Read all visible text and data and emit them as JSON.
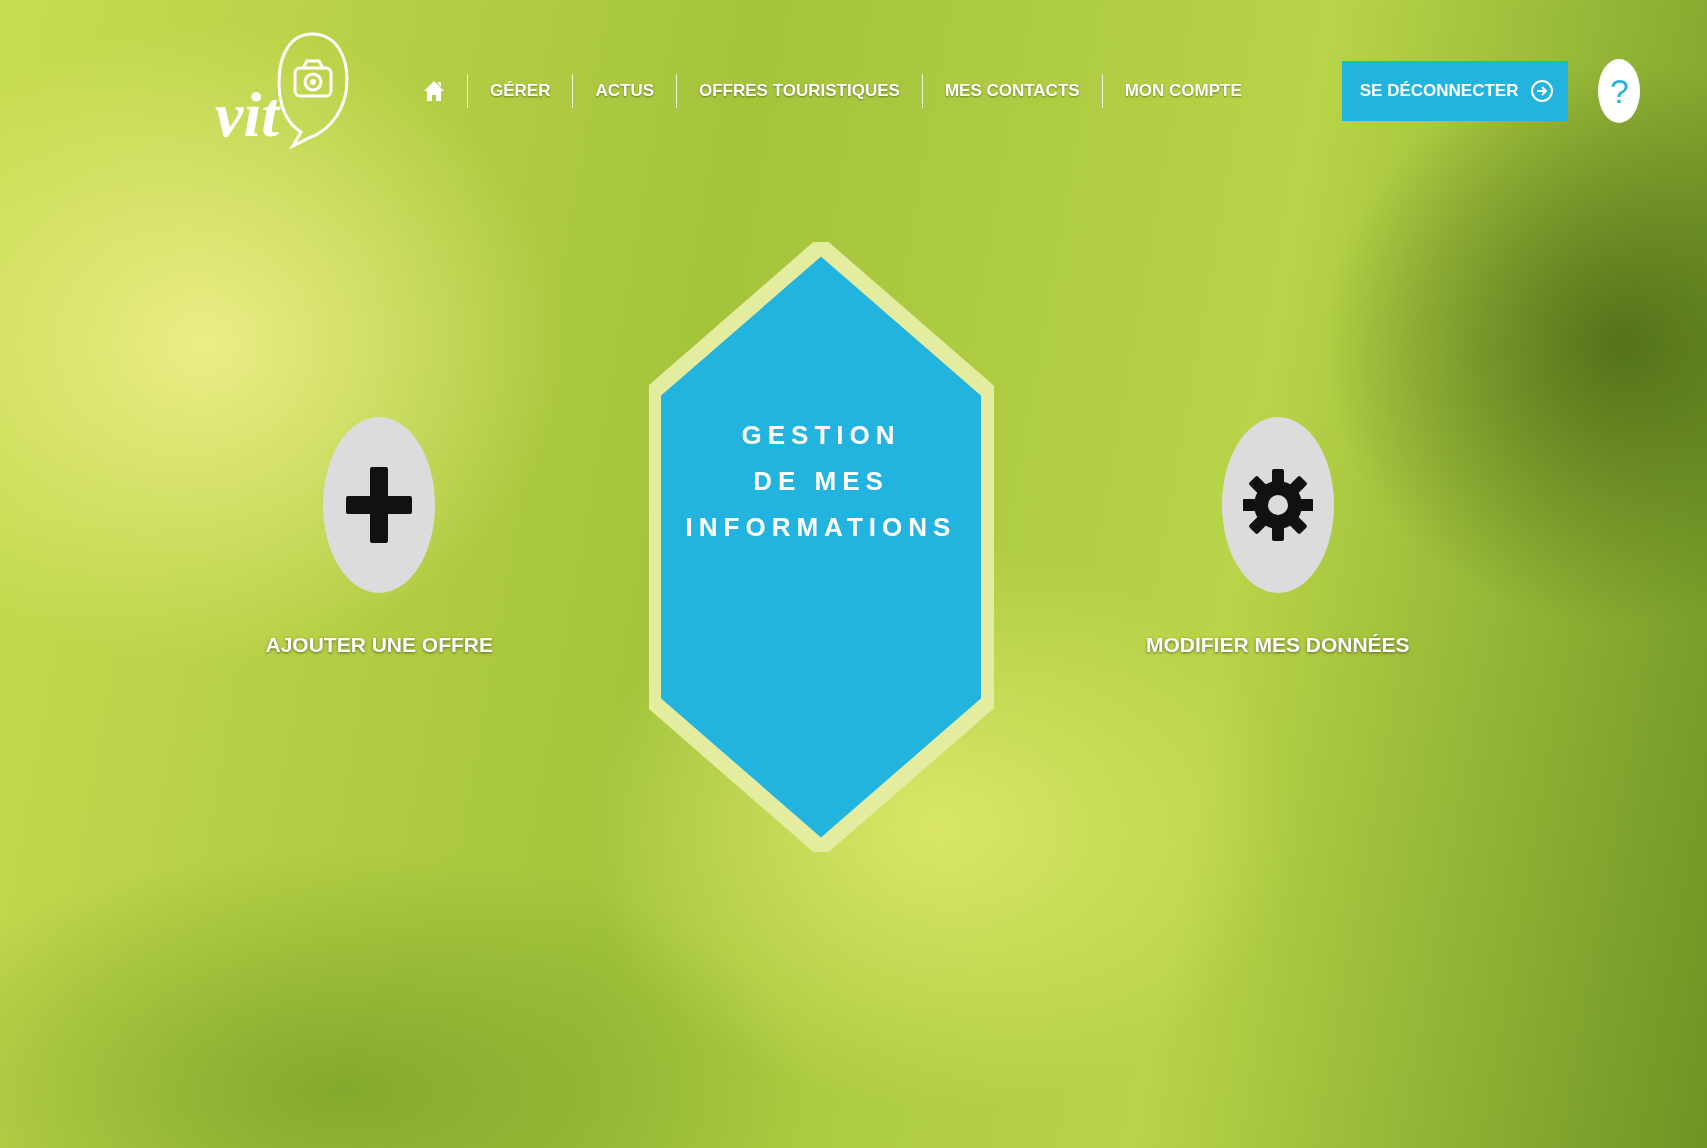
{
  "logo": {
    "text": "vit"
  },
  "nav": {
    "items": [
      {
        "kind": "home"
      },
      {
        "kind": "link",
        "label": "GÉRER"
      },
      {
        "kind": "link",
        "label": "ACTUS"
      },
      {
        "kind": "link",
        "label": "OFFRES TOURISTIQUES"
      },
      {
        "kind": "link",
        "label": "MES CONTACTS"
      },
      {
        "kind": "link",
        "label": "MON COMPTE"
      }
    ]
  },
  "logout_button": {
    "label": "SE DÉCONNECTER"
  },
  "help_button": {
    "label": "?"
  },
  "hexagon": {
    "title": "GESTION\nDE MES\nINFORMATIONS"
  },
  "actions": [
    {
      "kind": "add",
      "label": "AJOUTER UNE OFFRE"
    },
    {
      "kind": "settings",
      "label": "MODIFIER MES DONNÉES"
    }
  ]
}
